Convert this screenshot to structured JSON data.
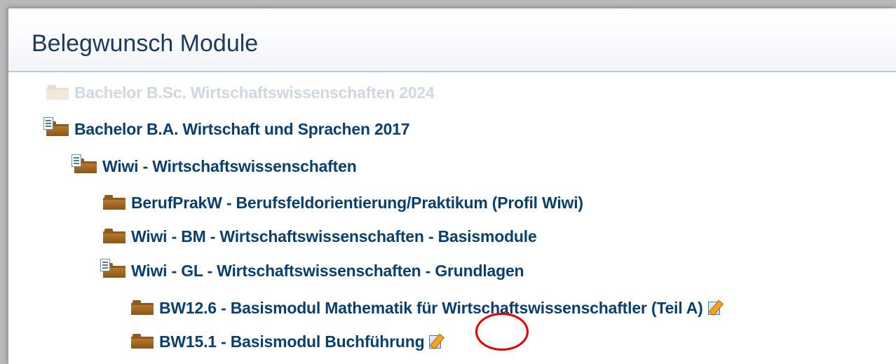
{
  "header": {
    "title": "Belegwunsch Module"
  },
  "tree": [
    {
      "label": "Bachelor B.Sc. Wirtschaftswissenschaften 2024"
    },
    {
      "label": "Bachelor B.A. Wirtschaft und Sprachen 2017"
    },
    {
      "label": "Wiwi - Wirtschaftswissenschaften"
    },
    {
      "label": "BerufPrakW - Berufsfeldorientierung/Praktikum (Profil Wiwi)"
    },
    {
      "label": "Wiwi - BM - Wirtschaftswissenschaften - Basismodule"
    },
    {
      "label": "Wiwi - GL - Wirtschaftswissenschaften - Grundlagen"
    },
    {
      "label": "BW12.6 - Basismodul Mathematik für Wirtschaftswissenschaftler (Teil A)"
    },
    {
      "label": "BW15.1 - Basismodul Buchführung"
    }
  ],
  "icons": {
    "folder": "folder-icon",
    "folder_open": "folder-with-document-icon",
    "edit": "edit-icon"
  },
  "colors": {
    "link": "#0a3f6e",
    "disabled": "#cfd8e1",
    "highlight": "#e40000"
  }
}
